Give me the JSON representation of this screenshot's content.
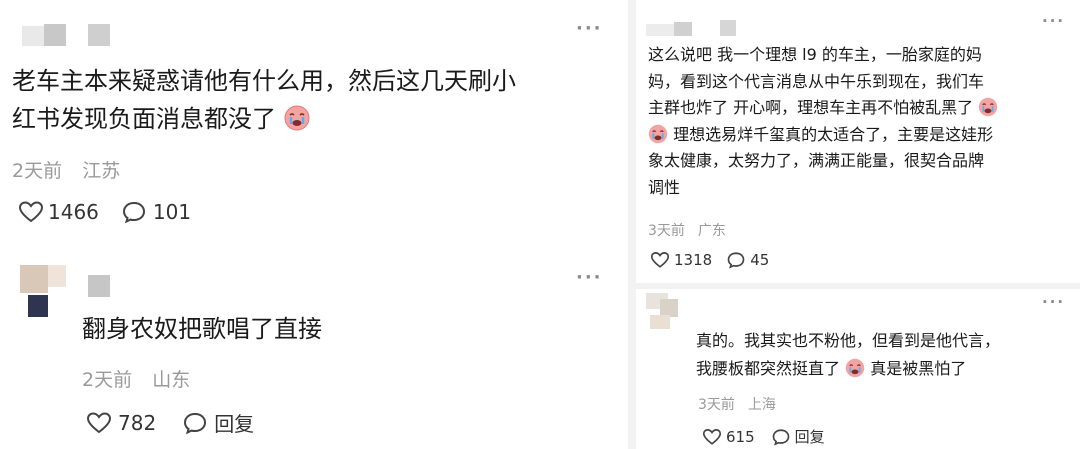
{
  "left": {
    "comments": [
      {
        "text_line1": "老车主本来疑惑请他有什么用，然后这几天刷小",
        "text_line2": "红书发现负面消息都没了",
        "time": "2天前",
        "location": "江苏",
        "likes": "1466",
        "replies": "101",
        "more": "···"
      },
      {
        "text": "翻身农奴把歌唱了直接",
        "time": "2天前",
        "location": "山东",
        "likes": "782",
        "reply_label": "回复",
        "more": "···"
      }
    ]
  },
  "right": {
    "comments": [
      {
        "lines": [
          "这么说吧 我一个理想 l9 的车主，一胎家庭的妈",
          "妈，看到这个代言消息从中午乐到现在，我们车",
          "主群也炸了 开心啊，理想车主再不怕被乱黑了",
          "理想选易烊千玺真的太适合了，主要是这娃形",
          "象太健康，太努力了，满满正能量，很契合品牌",
          "调性"
        ],
        "time": "3天前",
        "location": "广东",
        "likes": "1318",
        "replies": "45",
        "more": "···"
      },
      {
        "line1": "真的。我其实也不粉他，但看到是他代言，",
        "line2a": "我腰板都突然挺直了",
        "line2b": "真是被黑怕了",
        "time": "3天前",
        "location": "上海",
        "likes": "615",
        "reply_label": "回复",
        "more": "···"
      }
    ]
  },
  "icons": {
    "heart": "heart-outline-icon",
    "comment": "comment-bubble-icon",
    "crying": "crying-face-emoji"
  },
  "colors": {
    "meta": "#9a9a9a",
    "text": "#1a1a1a",
    "divider": "#f2f2f2"
  }
}
